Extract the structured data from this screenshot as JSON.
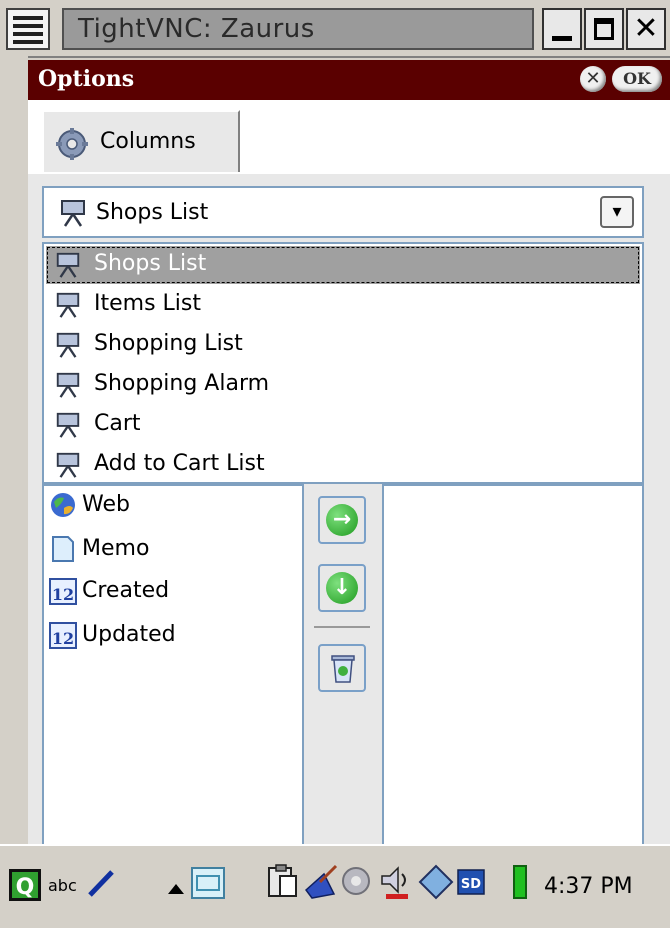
{
  "vnc": {
    "title": "TightVNC: Zaurus",
    "minimize_glyph": "_",
    "close_glyph": "✕"
  },
  "dialog": {
    "title": "Options",
    "close_glyph": "✕",
    "ok_label": "OK"
  },
  "tab": {
    "label": "Columns",
    "icon": "gear-icon"
  },
  "combo": {
    "selected": "Shops List",
    "arrow": "▾"
  },
  "dropdown": {
    "items": [
      {
        "label": "Shops List",
        "selected": true
      },
      {
        "label": "Items List",
        "selected": false
      },
      {
        "label": "Shopping List",
        "selected": false
      },
      {
        "label": "Shopping Alarm",
        "selected": false
      },
      {
        "label": "Cart",
        "selected": false
      },
      {
        "label": "Add to Cart List",
        "selected": false
      }
    ]
  },
  "available": {
    "items": [
      {
        "label": "Web",
        "icon": "globe-icon"
      },
      {
        "label": "Memo",
        "icon": "memo-icon"
      },
      {
        "label": "Created",
        "icon": "calendar-icon",
        "icon_text": "12"
      },
      {
        "label": "Updated",
        "icon": "calendar-icon",
        "icon_text": "12"
      }
    ]
  },
  "buttons": {
    "add_glyph": "→",
    "down_glyph": "↓"
  },
  "taskbar": {
    "input_mode": "abc",
    "sd_label": "SD",
    "time": "4:37 PM"
  },
  "colors": {
    "dialog_title_bg": "#5a0000",
    "selection_bg": "#a0a0a0",
    "accent_green": "#1e9a1e",
    "border_blue": "#7fa0c0"
  }
}
